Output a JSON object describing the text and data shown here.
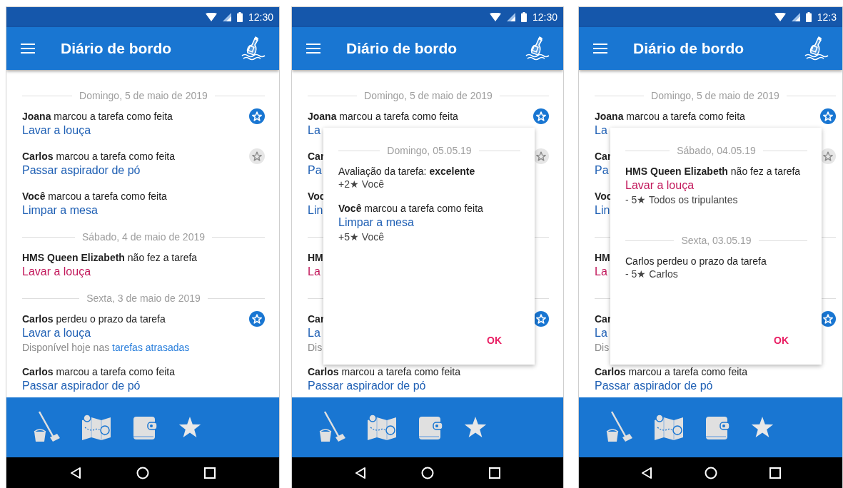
{
  "phones": [
    {
      "status_time": "12:30",
      "title": "Diário de bordo",
      "feed": [
        {
          "kind": "date",
          "text": "Domingo, 5 de maio de 2019"
        },
        {
          "kind": "event",
          "line": "**Joana** marcou a tarefa como feita",
          "task": "Lavar a louça",
          "missed": false,
          "star_badge": true,
          "star_active": true
        },
        {
          "kind": "event",
          "line": "**Carlos** marcou a tarefa como feita",
          "task": "Passar aspirador de pó",
          "missed": false,
          "star_badge": true,
          "star_active": false
        },
        {
          "kind": "event",
          "line": "**Você** marcou a tarefa como feita",
          "task": "Limpar a mesa",
          "missed": false,
          "star_badge": false
        },
        {
          "kind": "date",
          "text": "Sábado, 4 de maio de 2019"
        },
        {
          "kind": "event",
          "line": "**HMS Queen Elizabeth** não fez a tarefa",
          "task": "Lavar a louça",
          "missed": true,
          "star_badge": false
        },
        {
          "kind": "date",
          "text": "Sexta, 3 de maio de 2019"
        },
        {
          "kind": "event",
          "line": "**Carlos** perdeu o prazo da tarefa",
          "task": "Lavar a louça",
          "missed": false,
          "star_badge": true,
          "star_active": true,
          "note": "Disponível hoje nas ",
          "note_link": "tarefas atrasadas"
        },
        {
          "kind": "event",
          "line": "**Carlos** marcou a tarefa como feita",
          "task": "Passar aspirador de pó",
          "missed": false,
          "star_badge": false
        }
      ]
    },
    {
      "status_time": "12:30",
      "title": "Diário de bordo",
      "feed": [
        {
          "kind": "date",
          "text": "Domingo, 5 de maio de 2019"
        },
        {
          "kind": "event",
          "line": "**Joana** marcou a tarefa como feita",
          "task": "La",
          "missed": false,
          "star_badge": true,
          "star_active": true
        },
        {
          "kind": "event",
          "line": "**Car**",
          "task": "Pa",
          "missed": false,
          "star_badge": true,
          "star_active": false
        },
        {
          "kind": "event",
          "line": "**Voc**",
          "task": "Lin",
          "missed": false,
          "star_badge": false
        },
        {
          "kind": "date"
        },
        {
          "kind": "event",
          "line": "**HM**",
          "task": "La",
          "missed": true,
          "star_badge": false
        },
        {
          "kind": "date"
        },
        {
          "kind": "event",
          "line": "**Car**",
          "task": "La",
          "missed": false,
          "star_badge": true,
          "star_active": true,
          "note": "Dis"
        },
        {
          "kind": "event",
          "line": "**Carlos** marcou a tarefa como feita",
          "task": "Passar aspirador de pó",
          "missed": false,
          "star_badge": false
        }
      ],
      "dialog": {
        "sections": [
          {
            "date": "Domingo, 05.05.19",
            "entries": [
              {
                "line": "Avaliação da tarefa: **excelente**",
                "points": "+2★ Você"
              },
              {
                "line": "**Você** marcou a tarefa como feita",
                "task": "Limpar a mesa",
                "missed": false,
                "points": "+5★ Você"
              }
            ]
          }
        ],
        "button": "OK"
      }
    },
    {
      "status_time": "12:3",
      "title": "Diário de bordo",
      "feed": [
        {
          "kind": "date",
          "text": "Domingo, 5 de maio de 2019"
        },
        {
          "kind": "event",
          "line": "**Joana** marcou a tarefa como feita",
          "task": "La",
          "missed": false,
          "star_badge": true,
          "star_active": true
        },
        {
          "kind": "event",
          "line": "**Car**",
          "task": "Pa",
          "missed": false,
          "star_badge": true,
          "star_active": false
        },
        {
          "kind": "event",
          "line": "**Voc**",
          "task": "Lin",
          "missed": false,
          "star_badge": false
        },
        {
          "kind": "date"
        },
        {
          "kind": "event",
          "line": "**HM**",
          "task": "La",
          "missed": true,
          "star_badge": false
        },
        {
          "kind": "date"
        },
        {
          "kind": "event",
          "line": "**Car**",
          "task": "La",
          "missed": false,
          "star_badge": true,
          "star_active": true,
          "note": "Dis"
        },
        {
          "kind": "event",
          "line": "**Carlos** marcou a tarefa como feita",
          "task": "Passar aspirador de pó",
          "missed": false,
          "star_badge": false
        }
      ],
      "dialog": {
        "sections": [
          {
            "date": "Sábado, 04.05.19",
            "entries": [
              {
                "line": "**HMS Queen Elizabeth** não fez a tarefa",
                "task": "Lavar a louça",
                "missed": true,
                "points": "- 5★ Todos os tripulantes"
              }
            ]
          },
          {
            "date": "Sexta, 03.05.19",
            "entries": [
              {
                "line": "Carlos perdeu o prazo da tarefa",
                "points": "- 5★ Carlos"
              }
            ]
          }
        ],
        "button": "OK"
      }
    }
  ]
}
